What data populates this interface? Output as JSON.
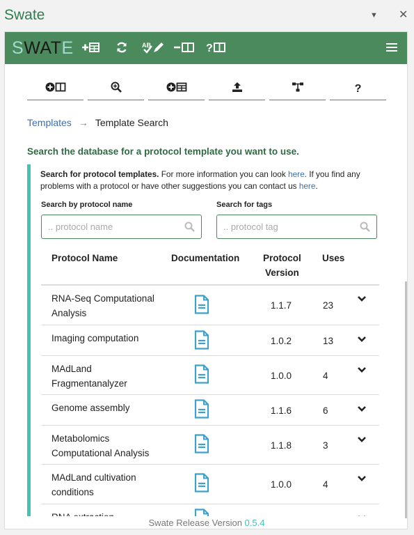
{
  "pane": {
    "title": "Swate",
    "dropdown_icon": "caret-down-icon",
    "close_icon": "close-icon"
  },
  "navbar": {
    "brand": {
      "l1": "S",
      "l2": "WAT",
      "l3": "E"
    },
    "icons": [
      "add-table-icon",
      "sync-icon",
      "spellcheck-icon",
      "remove-column-icon",
      "help-table-icon"
    ],
    "menu_icon": "hamburger-icon",
    "color": "#4a8a5c"
  },
  "tabs": [
    {
      "icon": "add-column-icon"
    },
    {
      "icon": "search-plus-icon"
    },
    {
      "icon": "add-template-icon"
    },
    {
      "icon": "upload-icon"
    },
    {
      "icon": "tree-icon"
    },
    {
      "icon": "question-icon"
    }
  ],
  "breadcrumb": {
    "link": "Templates",
    "arrow": "→",
    "current": "Template Search"
  },
  "heading": "Search the database for a protocol template you want to use.",
  "info": {
    "bold": "Search for protocol templates.",
    "text1": " For more information you can look ",
    "link1": "here",
    "text2": ". If you find any problems with a protocol or have other suggestions you can contact us ",
    "link2": "here",
    "text3": "."
  },
  "search": {
    "name_label": "Search by protocol name",
    "name_placeholder": ".. protocol name",
    "tag_label": "Search for tags",
    "tag_placeholder": ".. protocol tag"
  },
  "table": {
    "headers": {
      "name": "Protocol Name",
      "doc": "Documentation",
      "version_l1": "Protocol",
      "version_l2": "Version",
      "uses": "Uses"
    },
    "rows": [
      {
        "name": "RNA-Seq Computational Analysis",
        "version": "1.1.7",
        "uses": "23"
      },
      {
        "name": "Imaging computation",
        "version": "1.0.2",
        "uses": "13"
      },
      {
        "name": "MAdLand Fragmentanalyzer",
        "version": "1.0.0",
        "uses": "4"
      },
      {
        "name": "Genome assembly",
        "version": "1.1.6",
        "uses": "6"
      },
      {
        "name": "Metabolomics Computational Analysis",
        "version": "1.1.8",
        "uses": "3"
      },
      {
        "name": "MAdLand cultivation conditions",
        "version": "1.0.0",
        "uses": "4"
      },
      {
        "name": "RNA extraction",
        "version": "",
        "uses": ""
      }
    ]
  },
  "footer": {
    "label": "Swate Release Version ",
    "version": "0.5.4"
  },
  "accent": "#46c2b4",
  "link_color": "#3b6fb0"
}
